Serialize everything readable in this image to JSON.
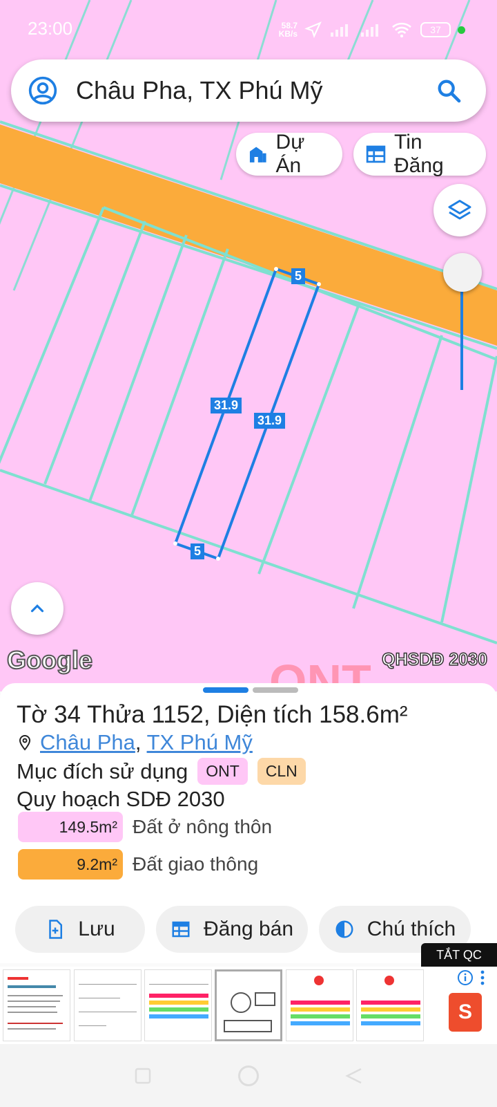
{
  "status": {
    "time": "23:00",
    "net_speed_value": "58.7",
    "net_speed_unit": "KB/s",
    "battery": "37",
    "battery_color": "#27c93f"
  },
  "search": {
    "query": "Châu Pha, TX Phú Mỹ",
    "left_icon": "account-icon",
    "right_icon": "search-icon"
  },
  "chips": {
    "du_an": "Dự Án",
    "tin_dang": "Tin Đăng"
  },
  "map": {
    "labels": {
      "top_side": "5",
      "left_side": "31.9",
      "right_side": "31.9",
      "bottom_side": "5"
    },
    "google_logo": "Google",
    "layer_badge": "QHSDĐ 2030",
    "colors": {
      "land_residential": "#ffc7f6",
      "road": "#fbab3b",
      "boundary": "#7fe0d0",
      "parcel_outline": "#1e7fe3"
    }
  },
  "sheet": {
    "parcel": {
      "prefix_to": "Tờ ",
      "to_number": "34",
      "label_thua": " Thửa ",
      "thua_number": "1152",
      "label_area": ", Diện tích ",
      "area": "158.6m²"
    },
    "location": {
      "commune": "Châu Pha",
      "separator": ", ",
      "town": "TX Phú Mỹ"
    },
    "purpose_label": "Mục đích sử dụng",
    "purpose_tags": [
      "ONT",
      "CLN"
    ],
    "plan_title": "Quy hoạch SDĐ 2030",
    "land_uses": [
      {
        "area": "149.5m²",
        "label": "Đất ở nông thôn",
        "color": "#ffc7f6"
      },
      {
        "area": "9.2m²",
        "label": "Đất giao thông",
        "color": "#fbab3b"
      }
    ],
    "actions": {
      "save": "Lưu",
      "post_sale": "Đăng bán",
      "legend": "Chú thích"
    }
  },
  "ad": {
    "close_label": "TẮT QC",
    "thumbnail_count": 6,
    "brand_logo": "shopee-bag-icon"
  }
}
